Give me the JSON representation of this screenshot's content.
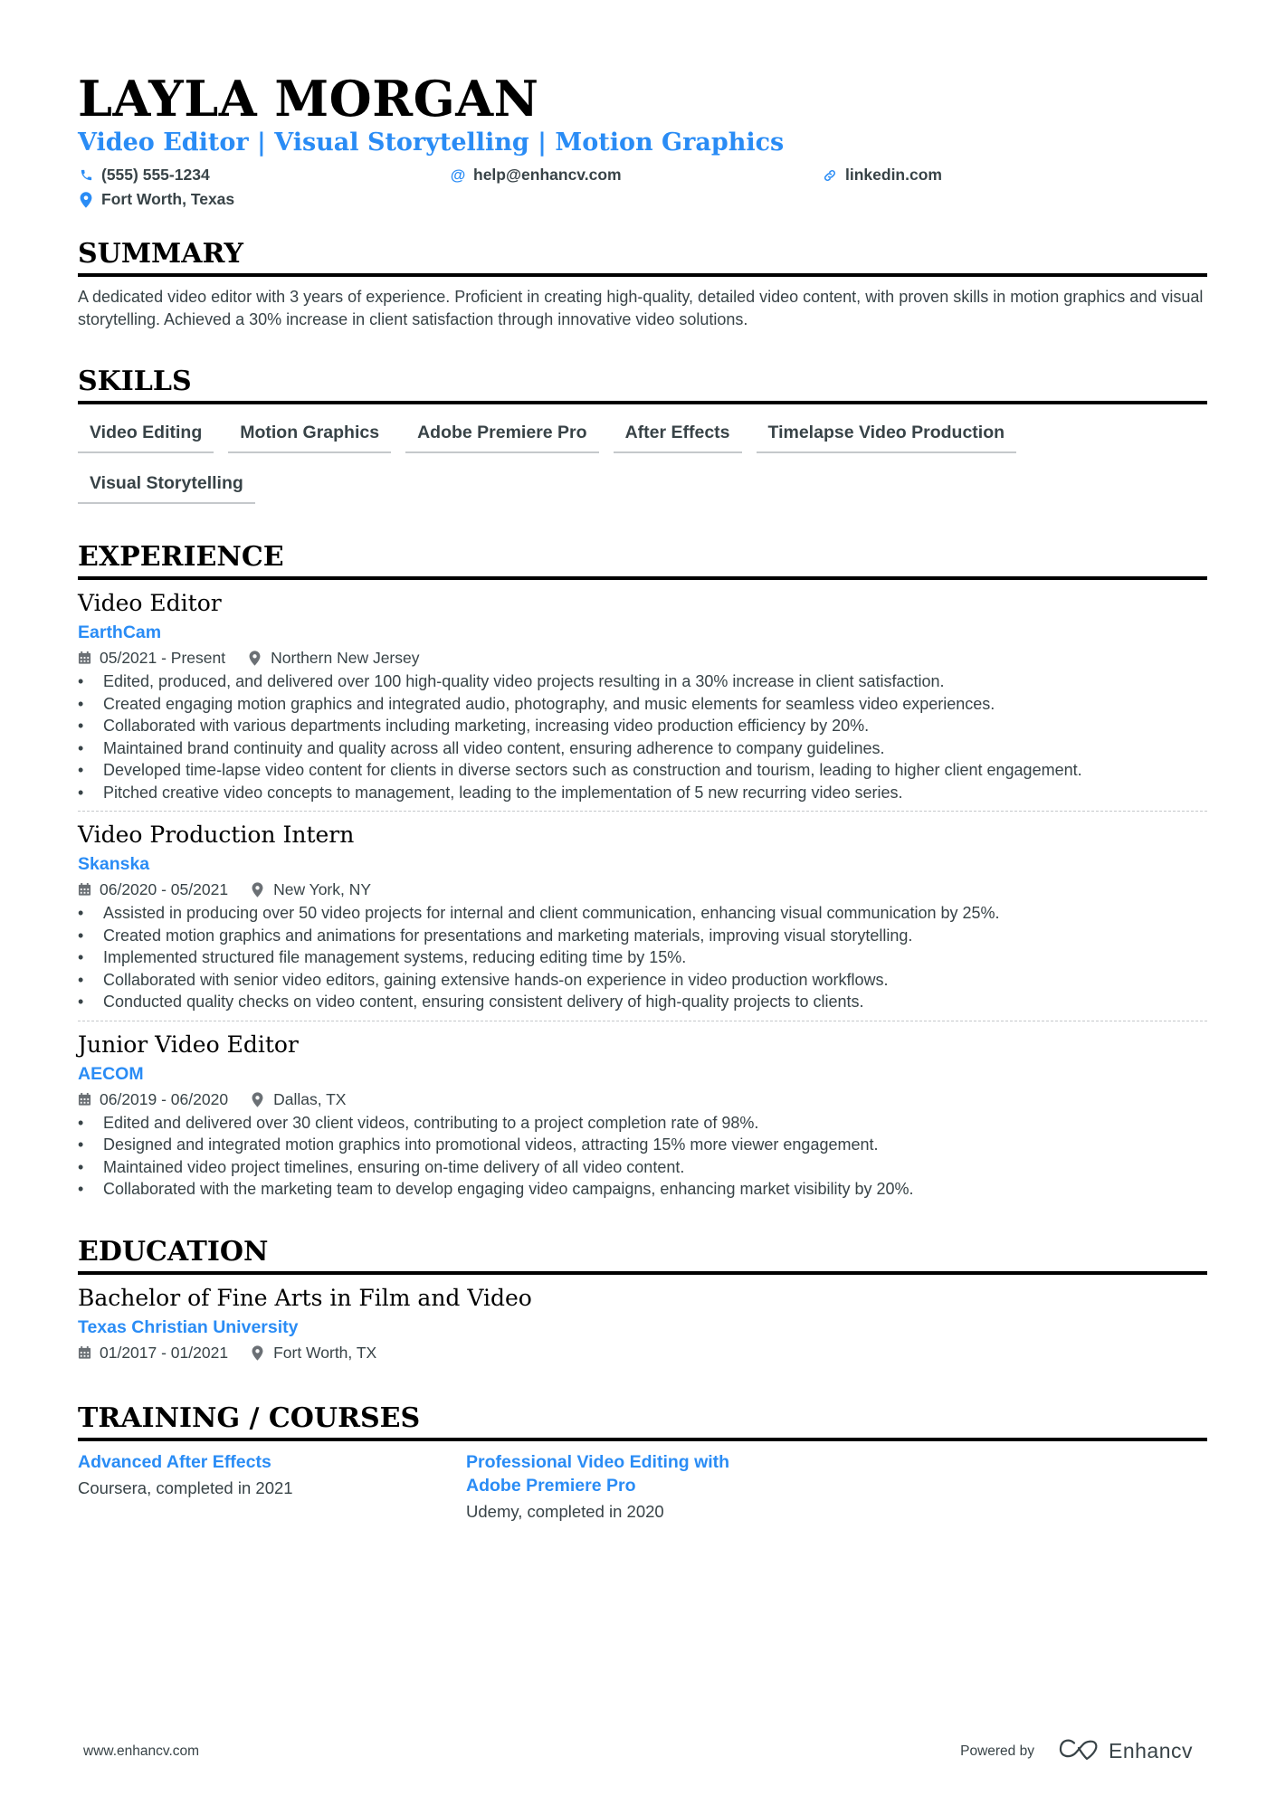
{
  "header": {
    "name": "LAYLA MORGAN",
    "headline": "Video Editor | Visual Storytelling | Motion Graphics",
    "contacts": [
      {
        "icon": "phone-icon",
        "text": "(555) 555-1234"
      },
      {
        "icon": "at-icon",
        "text": "help@enhancv.com"
      },
      {
        "icon": "link-icon",
        "text": "linkedin.com"
      },
      {
        "icon": "location-pin-icon",
        "text": "Fort Worth, Texas"
      }
    ]
  },
  "summary": {
    "title": "SUMMARY",
    "text": "A dedicated video editor with 3 years of experience. Proficient in creating high-quality, detailed video content, with proven skills in motion graphics and visual storytelling. Achieved a 30% increase in client satisfaction through innovative video solutions."
  },
  "skills": {
    "title": "SKILLS",
    "items": [
      "Video Editing",
      "Motion Graphics",
      "Adobe Premiere Pro",
      "After Effects",
      "Timelapse Video Production",
      "Visual Storytelling"
    ]
  },
  "experience": {
    "title": "EXPERIENCE",
    "jobs": [
      {
        "title": "Video Editor",
        "company": "EarthCam",
        "dates": "05/2021 - Present",
        "location": "Northern New Jersey",
        "bullets": [
          "Edited, produced, and delivered over 100 high-quality video projects resulting in a 30% increase in client satisfaction.",
          "Created engaging motion graphics and integrated audio, photography, and music elements for seamless video experiences.",
          "Collaborated with various departments including marketing, increasing video production efficiency by 20%.",
          "Maintained brand continuity and quality across all video content, ensuring adherence to company guidelines.",
          "Developed time-lapse video content for clients in diverse sectors such as construction and tourism, leading to higher client engagement.",
          "Pitched creative video concepts to management, leading to the implementation of 5 new recurring video series."
        ]
      },
      {
        "title": "Video Production Intern",
        "company": "Skanska",
        "dates": "06/2020 - 05/2021",
        "location": "New York, NY",
        "bullets": [
          "Assisted in producing over 50 video projects for internal and client communication, enhancing visual communication by 25%.",
          "Created motion graphics and animations for presentations and marketing materials, improving visual storytelling.",
          "Implemented structured file management systems, reducing editing time by 15%.",
          "Collaborated with senior video editors, gaining extensive hands-on experience in video production workflows.",
          "Conducted quality checks on video content, ensuring consistent delivery of high-quality projects to clients."
        ]
      },
      {
        "title": "Junior Video Editor",
        "company": "AECOM",
        "dates": "06/2019 - 06/2020",
        "location": "Dallas, TX",
        "bullets": [
          "Edited and delivered over 30 client videos, contributing to a project completion rate of 98%.",
          "Designed and integrated motion graphics into promotional videos, attracting 15% more viewer engagement.",
          "Maintained video project timelines, ensuring on-time delivery of all video content.",
          "Collaborated with the marketing team to develop engaging video campaigns, enhancing market visibility by 20%."
        ]
      }
    ]
  },
  "education": {
    "title": "EDUCATION",
    "degree": "Bachelor of Fine Arts in Film and Video",
    "school": "Texas Christian University",
    "dates": "01/2017 - 01/2021",
    "location": "Fort Worth, TX"
  },
  "training": {
    "title": "TRAINING / COURSES",
    "items": [
      {
        "title": "Advanced After Effects",
        "subtitle": "Coursera, completed in 2021"
      },
      {
        "title": "Professional Video Editing with Adobe Premiere Pro",
        "subtitle": "Udemy, completed in 2020"
      }
    ]
  },
  "footer": {
    "website": "www.enhancv.com",
    "powered_by": "Powered by",
    "brand": "Enhancv"
  },
  "colors": {
    "accent": "#2a8cf5",
    "text": "#384347",
    "heading": "#000000"
  }
}
